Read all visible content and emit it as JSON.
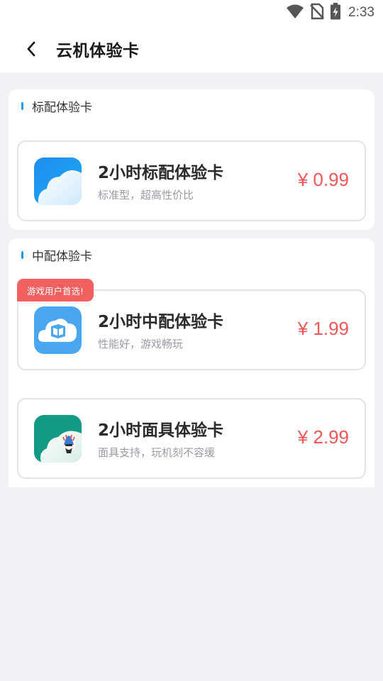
{
  "status_bar": {
    "time": "2:33",
    "icons": [
      "wifi-icon",
      "no-sim-icon",
      "battery-charging-icon"
    ]
  },
  "header": {
    "back_icon": "chevron-left-icon",
    "title": "云机体验卡"
  },
  "sections": [
    {
      "title": "标配体验卡",
      "cards": [
        {
          "icon": "cloud-icon",
          "name": "2小时标配体验卡",
          "desc": "标准型，超高性价比",
          "price": "¥ 0.99"
        }
      ]
    },
    {
      "title": "中配体验卡",
      "badge": "游戏用户首选!",
      "cards": [
        {
          "icon": "cloud-cube-icon",
          "name": "2小时中配体验卡",
          "desc": "性能好，游戏畅玩",
          "price": "¥ 1.99"
        },
        {
          "icon": "cloud-mask-icon",
          "name": "2小时面具体验卡",
          "desc": "面具支持，玩机刻不容缓",
          "price": "¥ 2.99"
        }
      ]
    }
  ],
  "colors": {
    "accent": "#1e9cf0",
    "price": "#f05656",
    "badge": "#f36060",
    "background": "#f2f2f4"
  }
}
